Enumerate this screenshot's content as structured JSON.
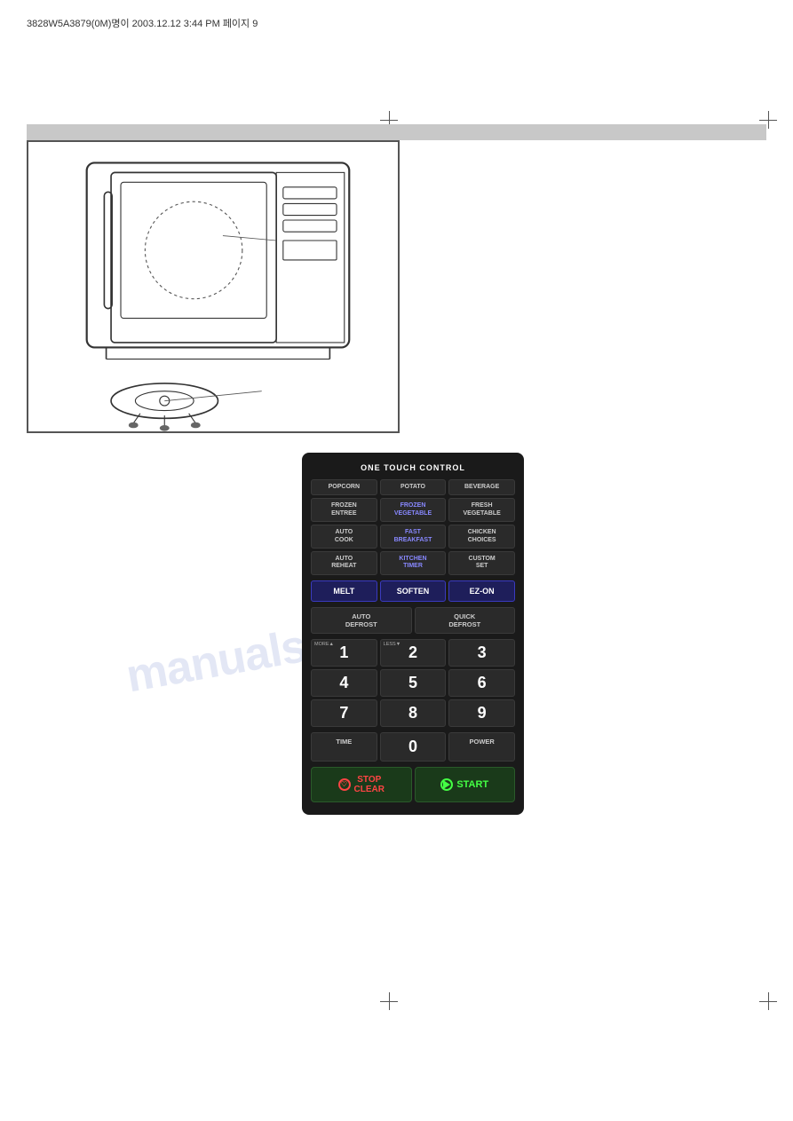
{
  "header": {
    "text": "3828W5A3879(0M)명이  2003.12.12 3:44 PM  페이지 9"
  },
  "panel": {
    "title": "ONE TOUCH CONTROL",
    "one_touch_buttons": [
      {
        "label": "POPCORN"
      },
      {
        "label": "POTATO"
      },
      {
        "label": "BEVERAGE"
      },
      {
        "label": "FROZEN\nENTREE"
      },
      {
        "label": "FROZEN\nVEGETABLE"
      },
      {
        "label": "FRESH\nVEGETABLE"
      },
      {
        "label": "AUTO\nCOOK"
      },
      {
        "label": "FAST\nBREAKFAST"
      },
      {
        "label": "CHICKEN\nCHOICES"
      },
      {
        "label": "AUTO\nREHEAT"
      },
      {
        "label": "KITCHEN\nTIMER"
      },
      {
        "label": "CUSTOM\nSET"
      }
    ],
    "special_buttons": [
      {
        "label": "MELT"
      },
      {
        "label": "SOFTEN"
      },
      {
        "label": "EZ-ON"
      }
    ],
    "defrost_buttons": [
      {
        "label": "AUTO\nDEFROST"
      },
      {
        "label": "QUICK\nDEFROST"
      }
    ],
    "numpad": [
      {
        "label": "1",
        "sub_left": "MORE ▲"
      },
      {
        "label": "2",
        "sub_left": "LESS ▼"
      },
      {
        "label": "3"
      },
      {
        "label": "4"
      },
      {
        "label": "5"
      },
      {
        "label": "6"
      },
      {
        "label": "7"
      },
      {
        "label": "8"
      },
      {
        "label": "9"
      }
    ],
    "time_label": "TIME",
    "zero_label": "0",
    "power_label": "POWER",
    "stop_label": "STOP\nCLEAR",
    "start_label": "START"
  },
  "watermark": "manualslib.com"
}
